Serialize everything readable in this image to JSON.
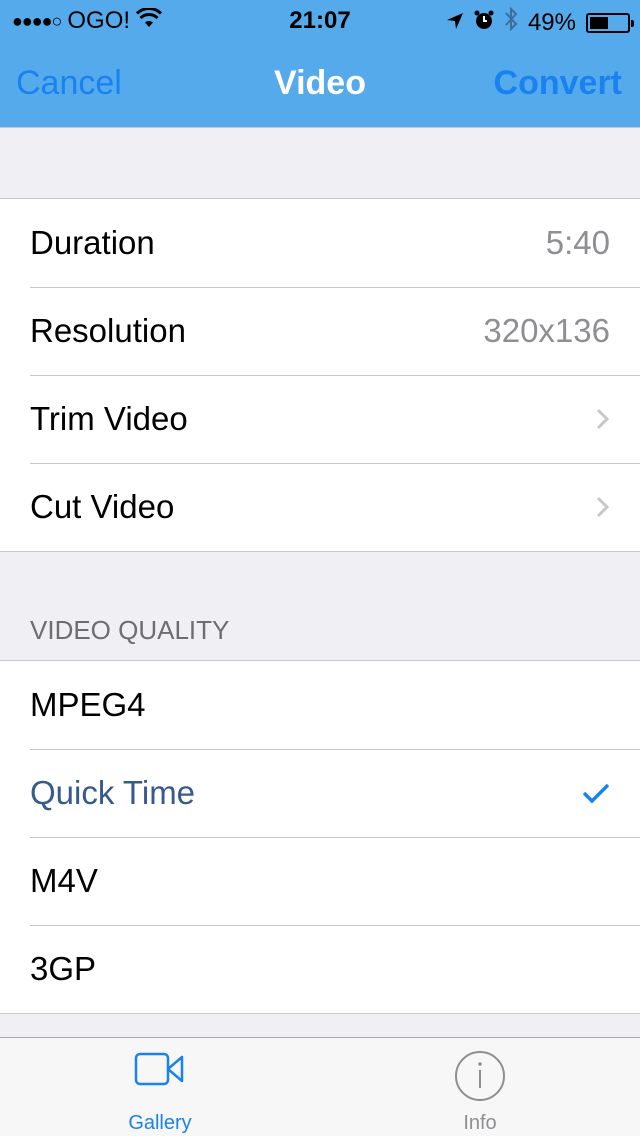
{
  "status_bar": {
    "signal": "●●●●○",
    "carrier": "OGO!",
    "time": "21:07",
    "battery_percent": "49%",
    "battery_level": 0.49
  },
  "navbar": {
    "cancel_label": "Cancel",
    "title": "Video",
    "convert_label": "Convert"
  },
  "info_rows": [
    {
      "label": "Duration",
      "value": "5:40"
    },
    {
      "label": "Resolution",
      "value": "320x136"
    },
    {
      "label": "Trim Video"
    },
    {
      "label": "Cut Video"
    }
  ],
  "video_quality": {
    "header": "VIDEO QUALITY",
    "options": [
      {
        "label": "MPEG4",
        "selected": false
      },
      {
        "label": "Quick Time",
        "selected": true
      },
      {
        "label": "M4V",
        "selected": false
      },
      {
        "label": "3GP",
        "selected": false
      }
    ]
  },
  "tabbar": {
    "tabs": [
      {
        "label": "Gallery",
        "icon": "video-camera-icon",
        "active": true
      },
      {
        "label": "Info",
        "icon": "info-icon",
        "active": false
      }
    ]
  },
  "colors": {
    "navbar_bg": "#55aaeb",
    "accent": "#1a82f0",
    "selected_text": "#375a8c"
  }
}
